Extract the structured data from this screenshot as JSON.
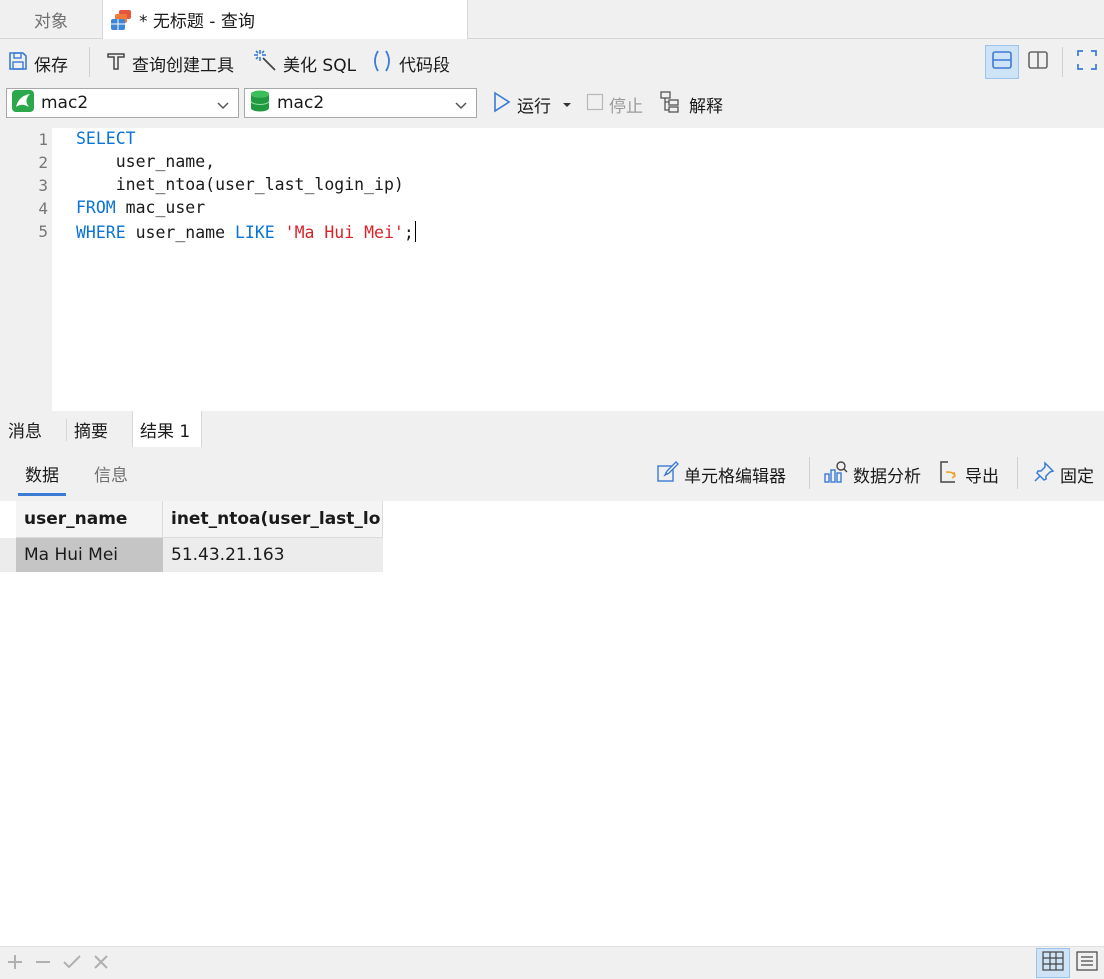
{
  "tabs": {
    "objects": "对象",
    "query": "* 无标题 - 查询"
  },
  "toolbar": {
    "save": "保存",
    "query_builder": "查询创建工具",
    "beautify": "美化 SQL",
    "snippet": "代码段"
  },
  "connection": {
    "connection_name": "mac2",
    "database_name": "mac2",
    "run": "运行",
    "stop": "停止",
    "explain": "解释"
  },
  "editor": {
    "line_numbers": [
      "1",
      "2",
      "3",
      "4",
      "5"
    ],
    "lines": [
      [
        {
          "t": "SELECT",
          "c": "kw"
        }
      ],
      [
        {
          "t": "    user_name,",
          "c": ""
        }
      ],
      [
        {
          "t": "    inet_ntoa(user_last_login_ip)",
          "c": ""
        }
      ],
      [
        {
          "t": "FROM",
          "c": "kw"
        },
        {
          "t": " mac_user",
          "c": ""
        }
      ],
      [
        {
          "t": "WHERE",
          "c": "kw"
        },
        {
          "t": " user_name ",
          "c": ""
        },
        {
          "t": "LIKE",
          "c": "kw"
        },
        {
          "t": " ",
          "c": ""
        },
        {
          "t": "'Ma Hui Mei'",
          "c": "str"
        },
        {
          "t": ";",
          "c": ""
        }
      ]
    ]
  },
  "result_tabs": {
    "messages": "消息",
    "summary": "摘要",
    "result1": "结果 1"
  },
  "data_tabs": {
    "data": "数据",
    "info": "信息"
  },
  "result_tools": {
    "cell_editor": "单元格编辑器",
    "analysis": "数据分析",
    "export": "导出",
    "pin": "固定"
  },
  "grid": {
    "columns": [
      "user_name",
      "inet_ntoa(user_last_lo"
    ],
    "rows": [
      [
        "Ma Hui Mei",
        "51.43.21.163"
      ]
    ]
  },
  "colors": {
    "accent": "#0a74d6",
    "string": "#d8232a",
    "toolbar_bg": "#f0f0f0"
  }
}
